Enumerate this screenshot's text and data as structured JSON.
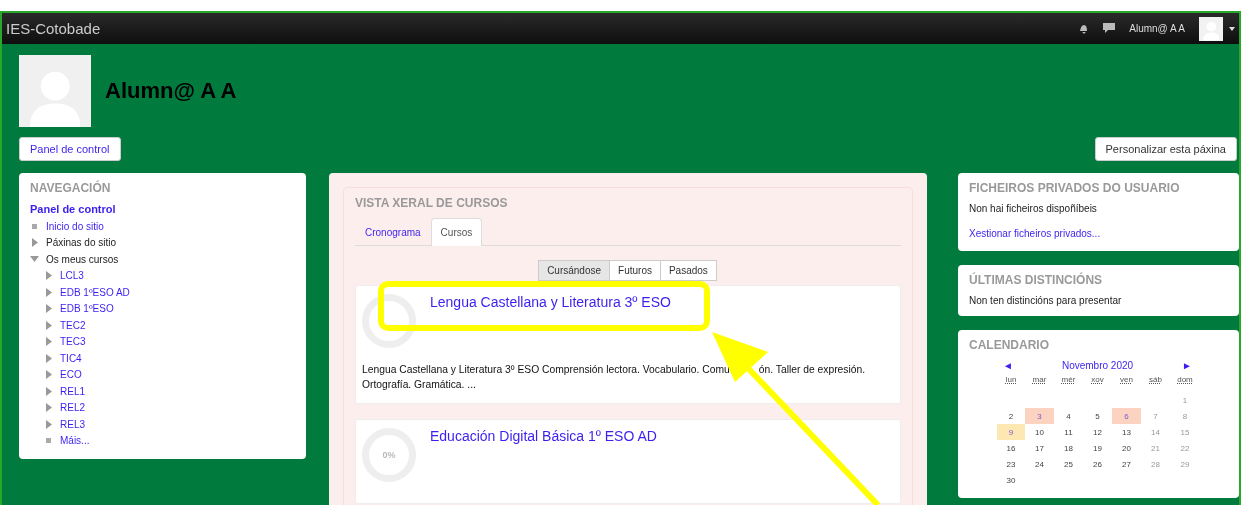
{
  "navbar": {
    "site_name": "IES-Cotobade",
    "user_name": "Alumn@ A A"
  },
  "header": {
    "user_name": "Alumn@ A A",
    "dashboard_button": "Panel de control",
    "customize_button": "Personalizar esta páxina"
  },
  "navigation": {
    "title": "NAVEGACIÓN",
    "root": "Panel de control",
    "items": [
      {
        "label": "Inicio do sitio",
        "kind": "leaf",
        "link": true
      },
      {
        "label": "Páxinas do sitio",
        "kind": "branch",
        "link": false,
        "expanded": false
      },
      {
        "label": "Os meus cursos",
        "kind": "branch",
        "link": false,
        "expanded": true,
        "children": [
          {
            "label": "LCL3",
            "kind": "branch",
            "link": true,
            "expanded": false
          },
          {
            "label": "EDB 1ºESO AD",
            "kind": "branch",
            "link": true,
            "expanded": false
          },
          {
            "label": "EDB 1ºESO",
            "kind": "branch",
            "link": true,
            "expanded": false
          },
          {
            "label": "TEC2",
            "kind": "branch",
            "link": true,
            "expanded": false
          },
          {
            "label": "TEC3",
            "kind": "branch",
            "link": true,
            "expanded": false
          },
          {
            "label": "TIC4",
            "kind": "branch",
            "link": true,
            "expanded": false
          },
          {
            "label": "ECO",
            "kind": "branch",
            "link": true,
            "expanded": false
          },
          {
            "label": "REL1",
            "kind": "branch",
            "link": true,
            "expanded": false
          },
          {
            "label": "REL2",
            "kind": "branch",
            "link": true,
            "expanded": false
          },
          {
            "label": "REL3",
            "kind": "branch",
            "link": true,
            "expanded": false
          },
          {
            "label": "Máis...",
            "kind": "leaf",
            "link": true
          }
        ]
      }
    ]
  },
  "overview": {
    "title": "VISTA XERAL DE CURSOS",
    "tabs": [
      {
        "label": "Cronograma",
        "selected": false
      },
      {
        "label": "Cursos",
        "selected": true
      }
    ],
    "filters": [
      {
        "label": "Cursándose",
        "selected": true
      },
      {
        "label": "Futuros",
        "selected": false
      },
      {
        "label": "Pasados",
        "selected": false
      }
    ],
    "courses": [
      {
        "title": "Lengua Castellana y Literatura 3º ESO",
        "summary": [
          "Lengua Castellana y Literatura 3º ESO Comprensión lectora. Vocabulario. Comu",
          "ón. Taller de expresión.",
          "Ortografía. Gramática. ..."
        ]
      },
      {
        "title": "Educación Digital Básica 1º ESO AD",
        "progress": "0%"
      }
    ]
  },
  "private_files": {
    "title": "FICHEIROS PRIVADOS DO USUARIO",
    "message": "Non hai ficheiros dispoñíbeis",
    "link": "Xestionar ficheiros privados..."
  },
  "badges": {
    "title": "ÚLTIMAS DISTINCIÓNS",
    "message": "Non ten distincións para presentar"
  },
  "calendar": {
    "title": "CALENDARIO",
    "prev": "◄",
    "month": "Novembro 2020",
    "next": "►",
    "weekdays": [
      "lun",
      "mar",
      "mér",
      "xov",
      "ven",
      "sáb",
      "dom"
    ],
    "weeks": [
      [
        {
          "kind": "blank"
        },
        {
          "kind": "blank"
        },
        {
          "kind": "blank"
        },
        {
          "kind": "blank"
        },
        {
          "kind": "blank"
        },
        {
          "kind": "blank"
        },
        {
          "day": "1",
          "kind": "plain"
        }
      ],
      [
        {
          "day": "2",
          "kind": "plain"
        },
        {
          "day": "3",
          "kind": "event"
        },
        {
          "day": "4",
          "kind": "plain"
        },
        {
          "day": "5",
          "kind": "plain"
        },
        {
          "day": "6",
          "kind": "event"
        },
        {
          "day": "7",
          "kind": "plain"
        },
        {
          "day": "8",
          "kind": "plain"
        }
      ],
      [
        {
          "day": "9",
          "kind": "today"
        },
        {
          "day": "10",
          "kind": "plain"
        },
        {
          "day": "11",
          "kind": "plain"
        },
        {
          "day": "12",
          "kind": "plain"
        },
        {
          "day": "13",
          "kind": "plain"
        },
        {
          "day": "14",
          "kind": "plain"
        },
        {
          "day": "15",
          "kind": "plain"
        }
      ],
      [
        {
          "day": "16",
          "kind": "plain"
        },
        {
          "day": "17",
          "kind": "plain"
        },
        {
          "day": "18",
          "kind": "plain"
        },
        {
          "day": "19",
          "kind": "plain"
        },
        {
          "day": "20",
          "kind": "plain"
        },
        {
          "day": "21",
          "kind": "plain"
        },
        {
          "day": "22",
          "kind": "plain"
        }
      ],
      [
        {
          "day": "23",
          "kind": "plain"
        },
        {
          "day": "24",
          "kind": "plain"
        },
        {
          "day": "25",
          "kind": "plain"
        },
        {
          "day": "26",
          "kind": "plain"
        },
        {
          "day": "27",
          "kind": "plain"
        },
        {
          "day": "28",
          "kind": "plain"
        },
        {
          "day": "29",
          "kind": "plain"
        }
      ],
      [
        {
          "day": "30",
          "kind": "plain"
        }
      ]
    ]
  }
}
